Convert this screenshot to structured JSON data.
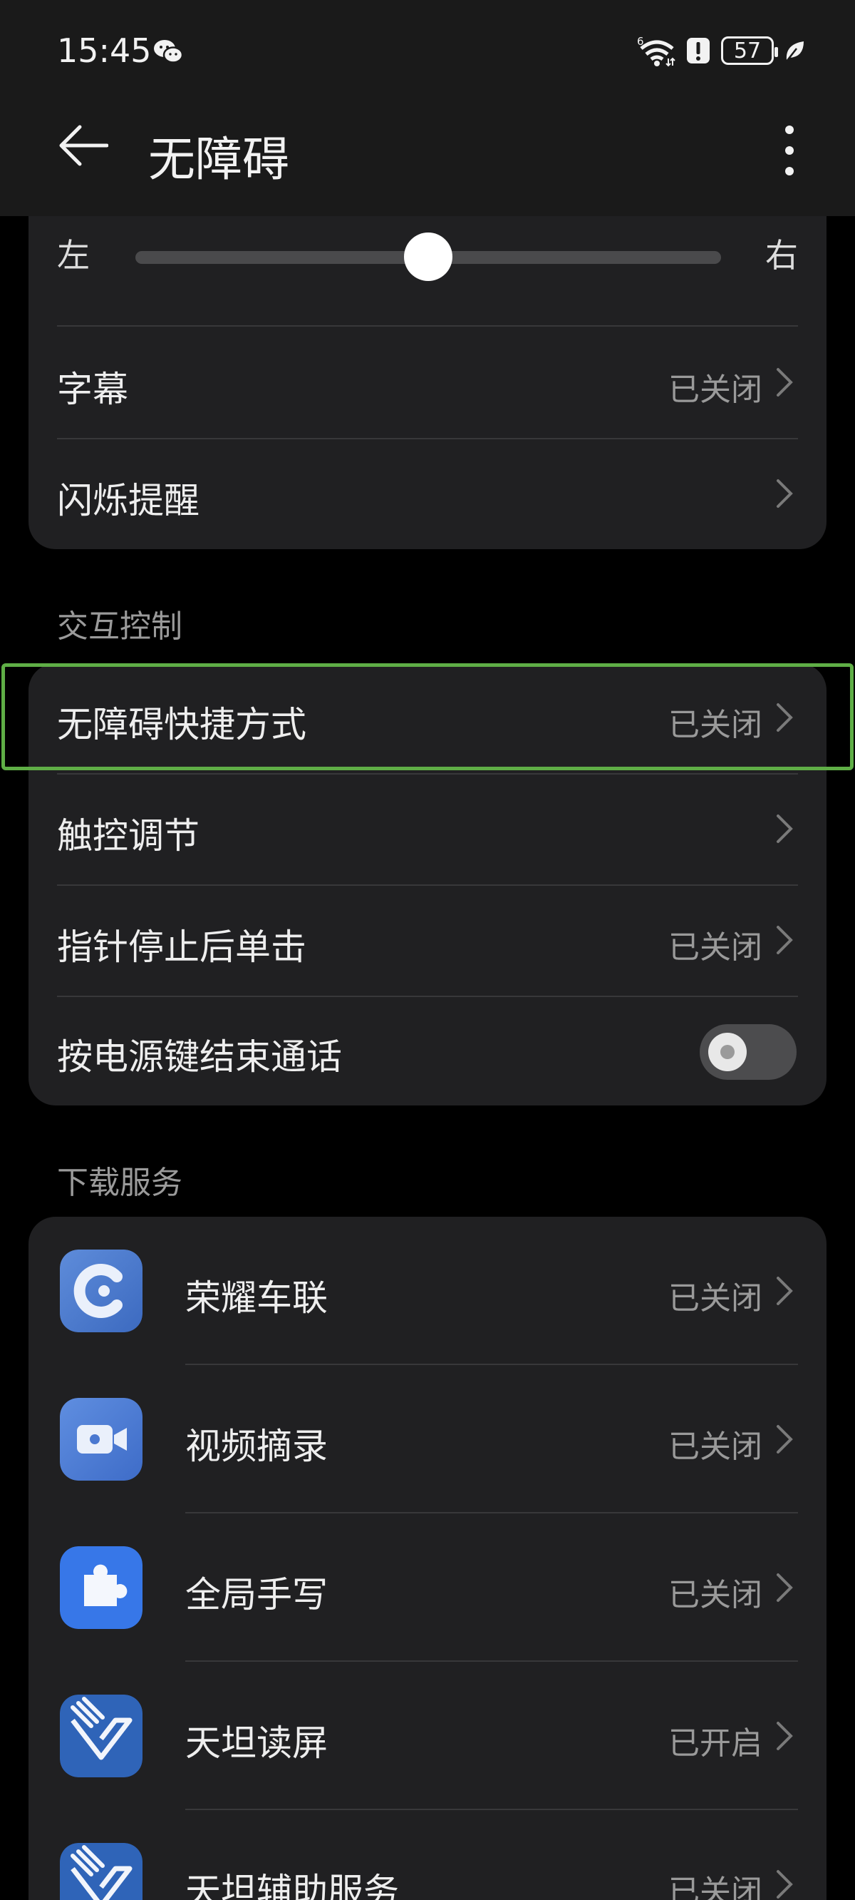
{
  "status_bar": {
    "time": "15:45",
    "wifi_label": "6",
    "battery": "57",
    "icons": [
      "wechat-icon",
      "wifi-icon",
      "alert-icon",
      "battery-icon",
      "leaf-icon"
    ]
  },
  "header": {
    "title": "无障碍",
    "icons": [
      "back-arrow-icon",
      "more-vertical-icon"
    ]
  },
  "balance_card": {
    "slider": {
      "left_label": "左",
      "right_label": "右",
      "value_fraction": 0.5
    },
    "rows": [
      {
        "label": "字幕",
        "value": "已关闭"
      },
      {
        "label": "闪烁提醒",
        "value": ""
      }
    ]
  },
  "interaction_section": {
    "title": "交互控制",
    "rows": [
      {
        "label": "无障碍快捷方式",
        "value": "已关闭"
      },
      {
        "label": "触控调节",
        "value": ""
      },
      {
        "label": "指针停止后单击",
        "value": "已关闭"
      },
      {
        "label": "按电源键结束通话",
        "toggle": false
      }
    ]
  },
  "download_section": {
    "title": "下载服务",
    "apps": [
      {
        "name": "荣耀车联",
        "value": "已关闭",
        "icon": "honor-carlink-icon"
      },
      {
        "name": "视频摘录",
        "value": "已关闭",
        "icon": "video-camera-icon"
      },
      {
        "name": "全局手写",
        "value": "已关闭",
        "icon": "puzzle-icon"
      },
      {
        "name": "天坦读屏",
        "value": "已开启",
        "icon": "tiantan-reader-icon"
      },
      {
        "name": "天坦辅助服务",
        "value": "已关闭",
        "icon": "tiantan-assist-icon"
      }
    ]
  },
  "colors": {
    "background": "#000000",
    "card": "#202022",
    "highlight": "#5FAE46",
    "secondary_text": "#9A9A9A"
  }
}
